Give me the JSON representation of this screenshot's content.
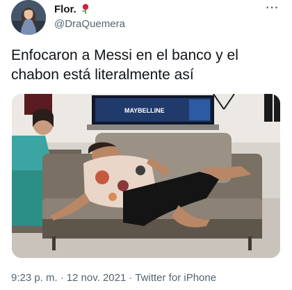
{
  "tweet": {
    "display_name": "Flor.",
    "emoji_icon": "rose-icon",
    "handle": "@DraQuemera",
    "more_icon": "more-options-icon",
    "text": "Enfocaron a Messi en el banco y el chabon está literalmente así",
    "media_sign_text": "MAYBELLINE",
    "time": "9:23 p. m.",
    "separator": "·",
    "date": "12 nov. 2021",
    "source": "Twitter for iPhone"
  },
  "colors": {
    "text_primary": "#0f1419",
    "text_secondary": "#536471"
  }
}
